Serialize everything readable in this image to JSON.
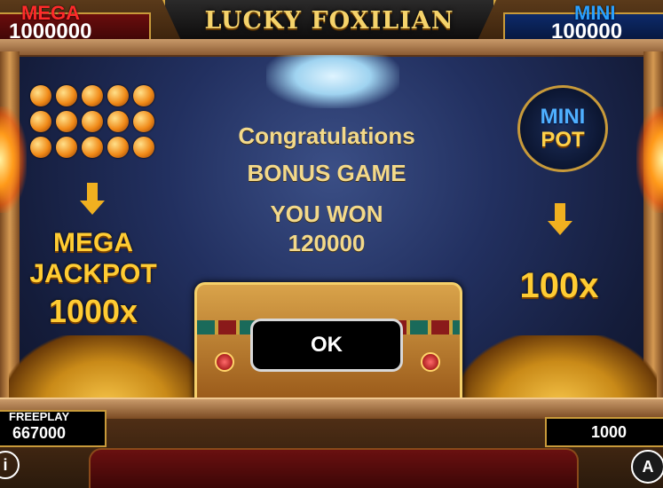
{
  "header": {
    "title": "LUCKY FOXILIAN",
    "jackpots": {
      "mega": {
        "label": "MEGA",
        "value": "1000000"
      },
      "mini": {
        "label": "MINI",
        "value": "100000"
      }
    }
  },
  "left_panel": {
    "line1": "MEGA",
    "line2": "JACKPOT",
    "multiplier": "1000x"
  },
  "right_panel": {
    "badge_line1": "MINI",
    "badge_line2": "POT",
    "multiplier": "100x"
  },
  "dialog": {
    "line1": "Congratulations",
    "line2": "BONUS GAME",
    "line3": "YOU WON",
    "amount": "120000",
    "ok_label": "OK"
  },
  "footer": {
    "freeplay_label": "FREEPLAY",
    "freeplay_value": "667000",
    "bet_value": "1000",
    "info_icon": "i",
    "auto_icon": "A"
  },
  "colors": {
    "gold": "#ffcc33",
    "mega_red": "#ff2a2a",
    "mini_blue": "#2aa0ff"
  }
}
